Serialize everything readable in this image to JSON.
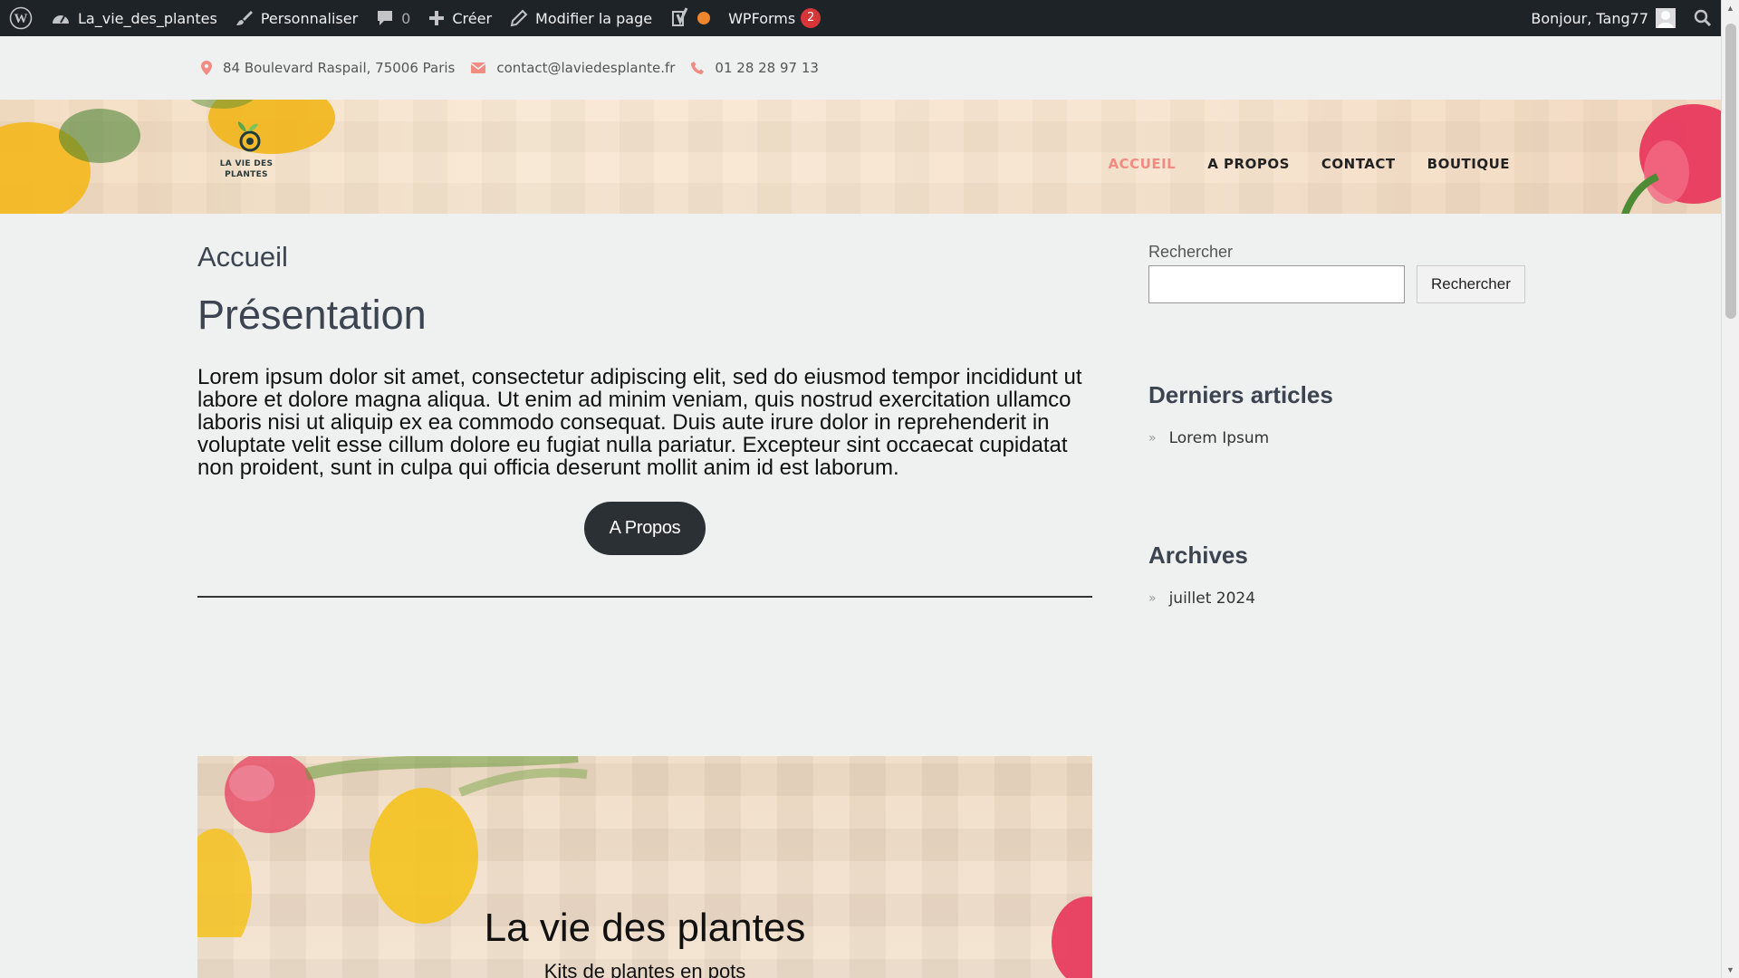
{
  "admin_bar": {
    "site_name": "La_vie_des_plantes",
    "customize": "Personnaliser",
    "comments_count": "0",
    "new": "Créer",
    "edit_page": "Modifier la page",
    "wpforms": "WPForms",
    "wpforms_badge": "2",
    "greeting": "Bonjour, Tang77"
  },
  "contact_bar": {
    "address": "84 Boulevard Raspail, 75006 Paris",
    "email": "contact@laviedesplante.fr",
    "phone": "01 28 28 97 13"
  },
  "header": {
    "logo_line1": "LA VIE DES",
    "logo_line2": "PLANTES",
    "nav": [
      "ACCUEIL",
      "A PROPOS",
      "CONTACT",
      "BOUTIQUE"
    ]
  },
  "main": {
    "page_title": "Accueil",
    "section_title": "Présentation",
    "paragraph": "Lorem ipsum dolor sit amet, consectetur adipiscing elit, sed do eiusmod tempor incididunt ut labore et dolore magna aliqua. Ut enim ad minim veniam, quis nostrud exercitation ullamco laboris nisi ut aliquip ex ea commodo consequat. Duis aute irure dolor in reprehenderit in voluptate velit esse cillum dolore eu fugiat nulla pariatur. Excepteur sint occaecat cupidatat non proident, sunt in culpa qui officia deserunt mollit anim id est laborum.",
    "button": "A Propos",
    "hero_title": "La vie des plantes",
    "hero_subtitle": "Kits de plantes en pots"
  },
  "sidebar": {
    "search_label": "Rechercher",
    "search_button": "Rechercher",
    "recent_title": "Derniers articles",
    "recent_items": [
      "Lorem Ipsum"
    ],
    "archives_title": "Archives",
    "archive_items": [
      "juillet 2024"
    ]
  },
  "colors": {
    "admin_bar_bg": "#1d2327",
    "nav_active": "#f28b82",
    "button_bg": "#2b3034",
    "badge": "#d63638",
    "contact_icons": "#f28b82"
  },
  "icons": [
    "wordpress-icon",
    "dashboard-icon",
    "brush-icon",
    "comment-icon",
    "plus-icon",
    "pencil-icon",
    "yoast-icon",
    "status-dot-icon",
    "user-avatar-icon",
    "search-icon",
    "map-pin-icon",
    "envelope-icon",
    "phone-icon",
    "chevron-right-icon"
  ]
}
